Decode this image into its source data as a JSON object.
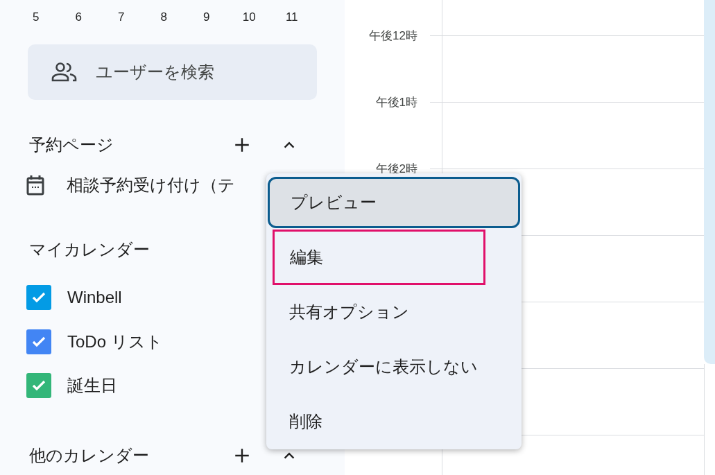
{
  "mini_calendar": {
    "days": [
      "5",
      "6",
      "7",
      "8",
      "9",
      "10",
      "11"
    ]
  },
  "user_search": {
    "placeholder": "ユーザーを検索"
  },
  "booking_pages": {
    "title": "予約ページ",
    "expanded": true,
    "items": [
      {
        "label": "相談予約受け付け（テ"
      }
    ]
  },
  "my_calendars": {
    "title": "マイカレンダー",
    "items": [
      {
        "label": "Winbell",
        "checked": true,
        "color": "#039be5"
      },
      {
        "label": "ToDo リスト",
        "checked": true,
        "color": "#4285f4"
      },
      {
        "label": "誕生日",
        "checked": true,
        "color": "#33b679"
      }
    ]
  },
  "other_calendars": {
    "title": "他のカレンダー",
    "expanded": true
  },
  "time_labels": [
    "午後12時",
    "午後1時",
    "午後2時"
  ],
  "context_menu": {
    "items": [
      {
        "label": "プレビュー",
        "selected": true,
        "annotated": false
      },
      {
        "label": "編集",
        "selected": false,
        "annotated": true
      },
      {
        "label": "共有オプション",
        "selected": false,
        "annotated": false
      },
      {
        "label": "カレンダーに表示しない",
        "selected": false,
        "annotated": false
      },
      {
        "label": "削除",
        "selected": false,
        "annotated": false
      }
    ]
  }
}
